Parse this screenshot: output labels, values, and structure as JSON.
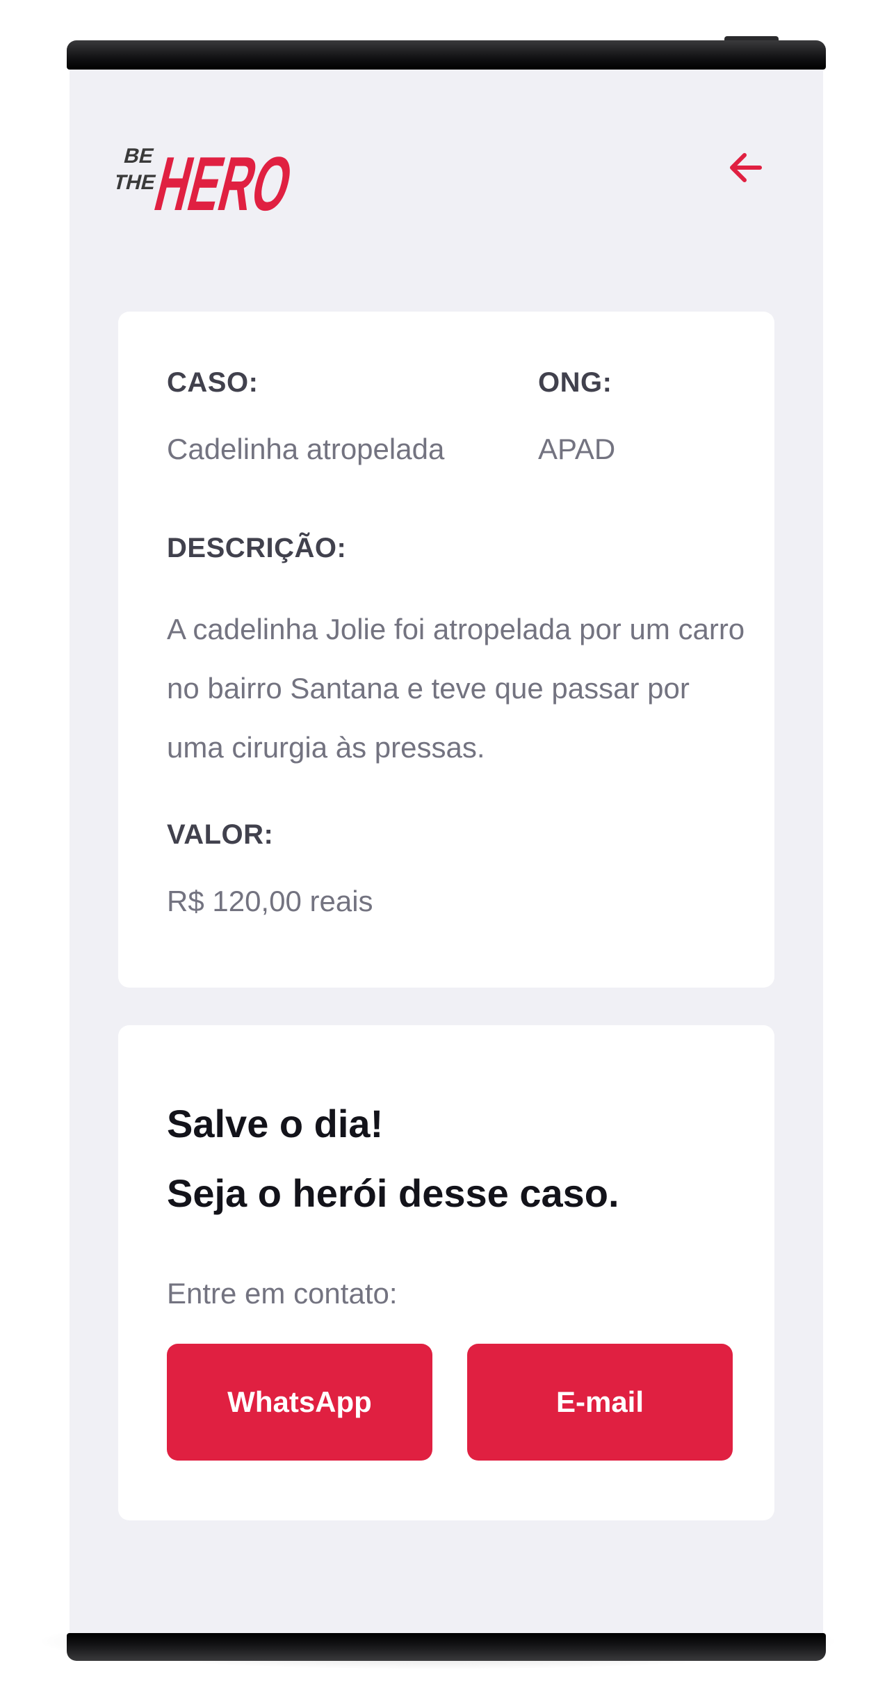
{
  "brand": {
    "logo_small_line1": "BE",
    "logo_small_line2": "THE",
    "logo_main": "HERO",
    "accent_color": "#e02041"
  },
  "header": {
    "back_icon": "arrow-left-icon"
  },
  "incident": {
    "case_label": "CASO:",
    "case_value": "Cadelinha atropelada",
    "ong_label": "ONG:",
    "ong_value": "APAD",
    "description_label": "DESCRIÇÃO:",
    "description_value": "A cadelinha Jolie foi atropelada por um carro no bairro Santana e teve que passar por uma cirurgia às pressas.",
    "value_label": "VALOR:",
    "value_value": "R$ 120,00 reais"
  },
  "contact": {
    "title_line1": "Salve o dia!",
    "title_line2": "Seja o herói desse caso.",
    "text": "Entre em contato:",
    "whatsapp_label": "WhatsApp",
    "email_label": "E-mail"
  }
}
